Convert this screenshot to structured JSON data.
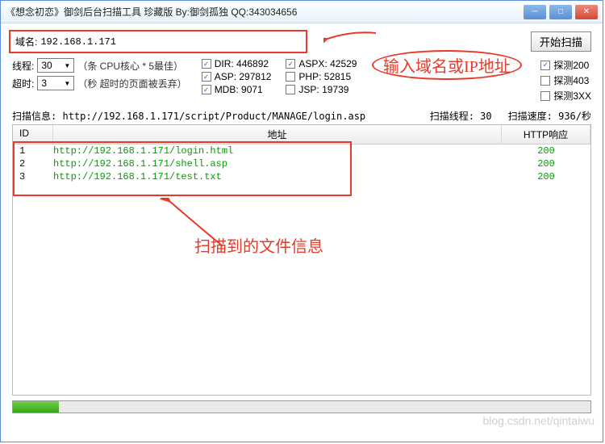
{
  "titlebar": {
    "title": "《想念初恋》御剑后台扫描工具 珍藏版 By:御剑孤独 QQ:343034656"
  },
  "domain": {
    "label": "域名:",
    "value": "192.168.1.171"
  },
  "scan_button": "开始扫描",
  "threads": {
    "label": "线程:",
    "value": "30",
    "hint": "（条 CPU核心 * 5最佳）"
  },
  "timeout": {
    "label": "超时:",
    "value": "3",
    "hint": "（秒 超时的页面被丢弃）"
  },
  "checks_col1": [
    {
      "label": "DIR: 446892",
      "checked": true
    },
    {
      "label": "ASP: 297812",
      "checked": true
    },
    {
      "label": "MDB: 9071",
      "checked": true
    }
  ],
  "checks_col2": [
    {
      "label": "ASPX: 42529",
      "checked": true
    },
    {
      "label": "PHP: 52815",
      "checked": false
    },
    {
      "label": "JSP: 19739",
      "checked": false
    }
  ],
  "checks_col3": [
    {
      "label": "探测200",
      "checked": true
    },
    {
      "label": "探测403",
      "checked": false
    },
    {
      "label": "探测3XX",
      "checked": false
    }
  ],
  "status": {
    "info_label": "扫描信息:",
    "info_value": "http://192.168.1.171/script/Product/MANAGE/login.asp",
    "threads_label": "扫描线程:",
    "threads_value": "30",
    "speed_label": "扫描速度:",
    "speed_value": "936/秒"
  },
  "table": {
    "headers": {
      "id": "ID",
      "url": "地址",
      "resp": "HTTP响应"
    },
    "rows": [
      {
        "id": "1",
        "url": "http://192.168.1.171/login.html",
        "resp": "200"
      },
      {
        "id": "2",
        "url": "http://192.168.1.171/shell.asp",
        "resp": "200"
      },
      {
        "id": "3",
        "url": "http://192.168.1.171/test.txt",
        "resp": "200"
      }
    ]
  },
  "annotations": {
    "top": "输入域名或IP地址",
    "mid": "扫描到的文件信息"
  },
  "watermark": "blog.csdn.net/qintaiwu"
}
